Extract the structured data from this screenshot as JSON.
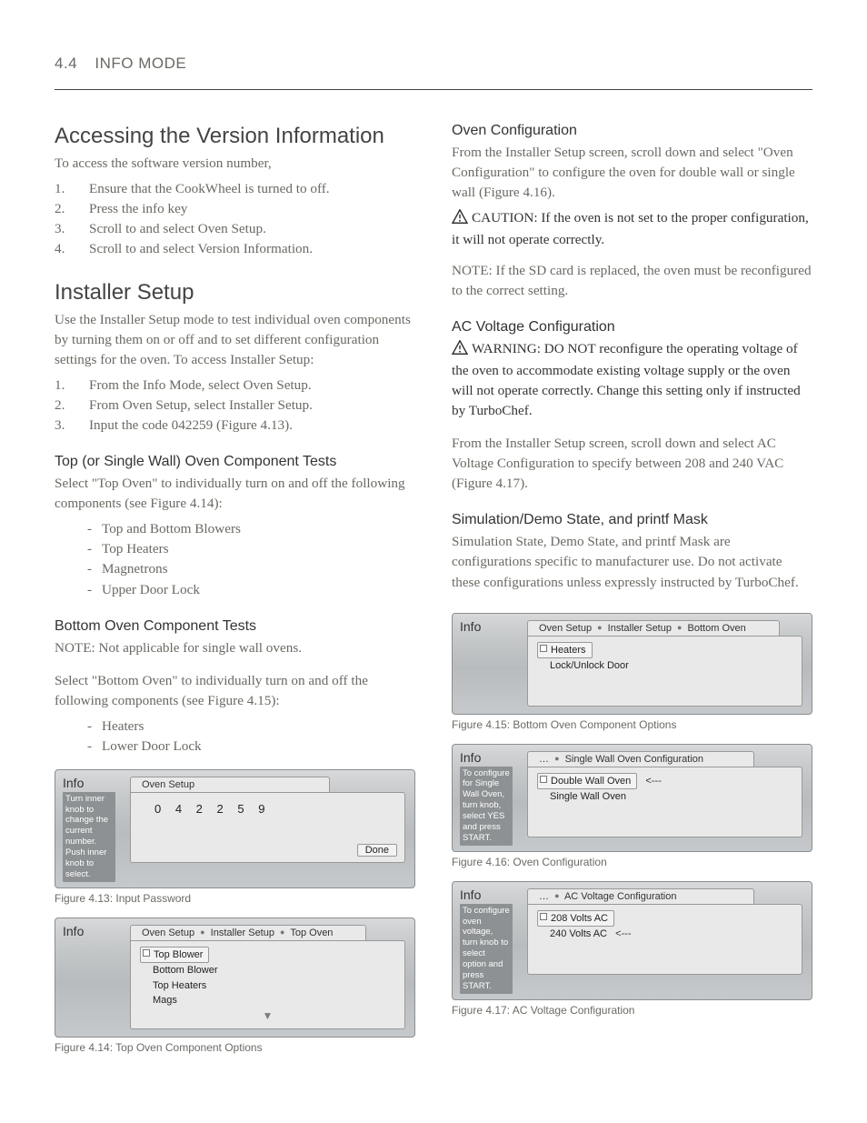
{
  "header": {
    "section_num": "4.4",
    "section_title": "INFO MODE"
  },
  "left": {
    "h_access": "Accessing the Version Information",
    "access_intro": "To access the software version number,",
    "access_steps": [
      "Ensure that the CookWheel is turned to off.",
      "Press the info key",
      "Scroll to and select Oven Setup.",
      "Scroll to and select Version Information."
    ],
    "h_installer": "Installer Setup",
    "installer_intro": "Use the Installer Setup mode to test individual oven components by turning them on or off and to set different configuration settings for the oven. To access Installer Setup:",
    "installer_steps": [
      "From the Info Mode, select Oven Setup.",
      "From Oven Setup, select Installer Setup.",
      "Input the code 042259 (Figure 4.13)."
    ],
    "h_top_tests": "Top (or Single Wall) Oven Component Tests",
    "top_intro": "Select \"Top Oven\" to individually turn on and off the following components (see Figure 4.14):",
    "top_list": [
      "Top and Bottom Blowers",
      "Top Heaters",
      "Magnetrons",
      "Upper Door Lock"
    ],
    "h_bottom_tests": "Bottom Oven Component Tests",
    "bottom_note": "NOTE: Not applicable for single wall ovens.",
    "bottom_intro": "Select \"Bottom Oven\" to individually turn on and off the following components (see Figure 4.15):",
    "bottom_list": [
      "Heaters",
      "Lower Door Lock"
    ]
  },
  "right": {
    "h_ovencfg": "Oven Configuration",
    "ovencfg_intro": "From the Installer Setup screen, scroll down and select \"Oven Configuration\" to configure the oven for double wall or single wall (Figure 4.16).",
    "ovencfg_caution": "CAUTION: If the oven is not set to the proper configuration, it will not operate correctly.",
    "ovencfg_note": "NOTE: If the SD card is replaced, the oven must be reconfigured to the correct setting.",
    "h_ac": "AC Voltage Configuration",
    "ac_warning": "WARNING: DO NOT reconfigure the operating voltage of the oven to accommodate existing voltage supply or the oven will not operate correctly. Change this setting only if instructed by TurboChef.",
    "ac_intro": "From the Installer Setup screen, scroll down and select AC Voltage Configuration to specify between 208 and 240 VAC (Figure 4.17).",
    "h_sim": "Simulation/Demo State, and printf Mask",
    "sim_body": "Simulation State, Demo State, and printf Mask are configurations specific to manufacturer use. Do not activate these configurations unless expressly instructed by TurboChef."
  },
  "fig413": {
    "info": "Info",
    "sidebar": "Turn inner knob to change the current number. Push inner knob to select.",
    "tab": "Oven Setup",
    "code": "0 4 2 2 5 9",
    "done": "Done",
    "caption": "Figure 4.13: Input Password"
  },
  "fig414": {
    "info": "Info",
    "crumbs": [
      "Oven Setup",
      "Installer Setup",
      "Top Oven"
    ],
    "items": [
      "Top Blower",
      "Bottom Blower",
      "Top Heaters",
      "Mags"
    ],
    "caption": "Figure 4.14: Top Oven Component Options"
  },
  "fig415": {
    "info": "Info",
    "crumbs": [
      "Oven Setup",
      "Installer Setup",
      "Bottom Oven"
    ],
    "items": [
      "Heaters",
      "Lock/Unlock Door"
    ],
    "caption": "Figure 4.15: Bottom Oven Component Options"
  },
  "fig416": {
    "info": "Info",
    "sidebar": "To configure for Single Wall Oven, turn knob, select YES and press START.",
    "crumbs": [
      "…",
      "Single Wall Oven Configuration"
    ],
    "items": [
      "Double Wall Oven",
      "Single Wall Oven"
    ],
    "arrow": "<---",
    "caption": "Figure 4.16: Oven Configuration"
  },
  "fig417": {
    "info": "Info",
    "sidebar": "To configure oven voltage, turn knob to select option and press START.",
    "crumbs": [
      "…",
      "AC Voltage Configuration"
    ],
    "items": [
      "208 Volts AC",
      "240 Volts AC"
    ],
    "arrow": "<---",
    "caption": "Figure 4.17: AC Voltage Configuration"
  }
}
